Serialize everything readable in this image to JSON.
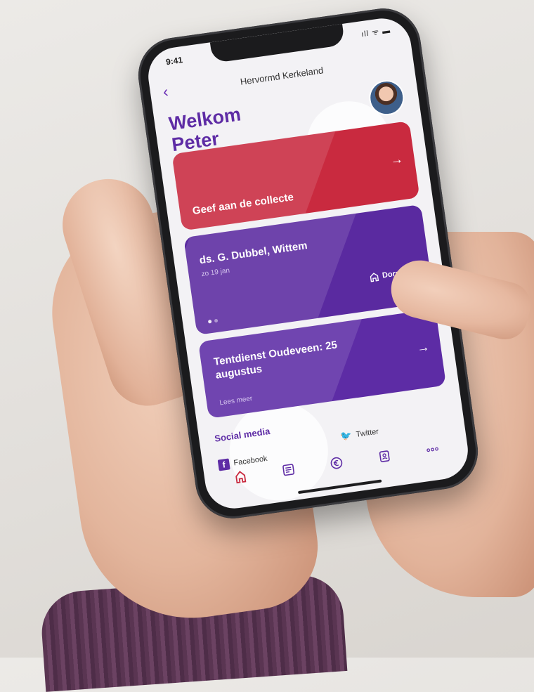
{
  "status": {
    "time": "9:41",
    "icons": "ıll ᯤ ▬"
  },
  "header": {
    "back_icon": "chevron-left-icon",
    "church_name": "Hervormd Kerkeland"
  },
  "welcome": {
    "line1": "Welkom",
    "line2": "Peter"
  },
  "cards": {
    "collecte": {
      "title": "Geef aan de collecte",
      "arrow": "→"
    },
    "service": {
      "title": "ds. G. Dubbel, Wittem",
      "date": "zo 19 jan",
      "location": "Dorpskerk"
    },
    "news": {
      "title": "Tentdienst Oudeveen: 25 augustus",
      "link": "Lees meer",
      "arrow": "→"
    }
  },
  "social": {
    "title": "Social media",
    "facebook": "Facebook",
    "twitter": "Twitter"
  },
  "tabbar": {
    "items": [
      {
        "icon": "church-icon",
        "active": true
      },
      {
        "icon": "news-icon",
        "active": false
      },
      {
        "icon": "euro-icon",
        "active": false
      },
      {
        "icon": "contacts-icon",
        "active": false
      },
      {
        "icon": "more-icon",
        "active": false
      }
    ]
  },
  "colors": {
    "primary_purple": "#5e2ca5",
    "accent_red": "#c92a3f",
    "screen_bg": "#f3f2f5"
  }
}
